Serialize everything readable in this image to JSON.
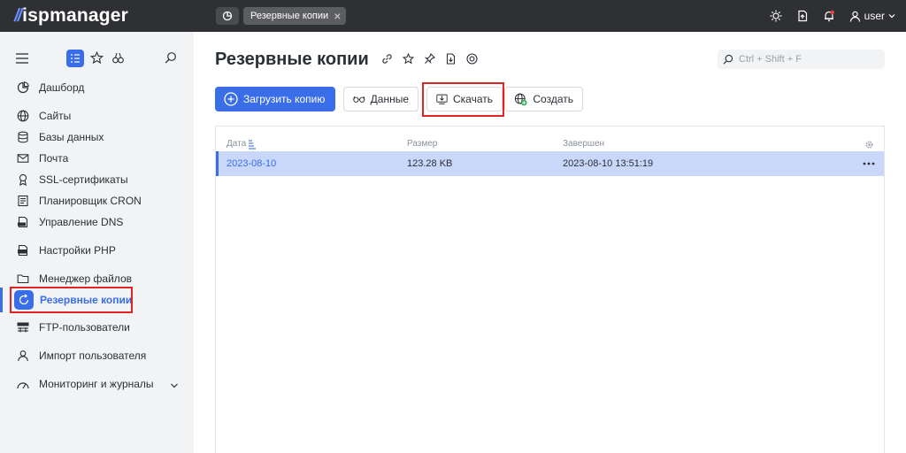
{
  "topbar": {
    "logo_mark": "//",
    "logo_text": "ispmanager",
    "tab_label": "Резервные копии",
    "tab_close": "×",
    "user_label": "user"
  },
  "sidebar": {
    "items": [
      {
        "label": "Дашборд",
        "icon": "dashboard-icon"
      },
      {
        "label": "Сайты",
        "icon": "globe-icon"
      },
      {
        "label": "Базы данных",
        "icon": "database-icon"
      },
      {
        "label": "Почта",
        "icon": "mail-icon"
      },
      {
        "label": "SSL-сертификаты",
        "icon": "certificate-icon"
      },
      {
        "label": "Планировщик CRON",
        "icon": "cron-icon"
      },
      {
        "label": "Управление DNS",
        "icon": "dns-icon"
      },
      {
        "label": "Настройки PHP",
        "icon": "php-icon"
      },
      {
        "label": "Менеджер файлов",
        "icon": "folder-icon"
      },
      {
        "label": "Резервные копии",
        "icon": "backup-icon",
        "active": true
      },
      {
        "label": "FTP-пользователи",
        "icon": "ftp-icon"
      },
      {
        "label": "Импорт пользователя",
        "icon": "user-import-icon"
      },
      {
        "label": "Мониторинг и журналы",
        "icon": "monitoring-icon"
      }
    ]
  },
  "main": {
    "title": "Резервные копии",
    "search_placeholder": "Ctrl + Shift + F",
    "toolbar": {
      "upload_label": "Загрузить копию",
      "data_label": "Данные",
      "download_label": "Скачать",
      "create_label": "Создать"
    },
    "table": {
      "columns": [
        "Дата",
        "Размер",
        "Завершен"
      ],
      "rows": [
        {
          "date": "2023-08-10",
          "size": "123.28 KB",
          "finished": "2023-08-10 13:51:19"
        }
      ]
    }
  },
  "colors": {
    "accent": "#3a6ee8",
    "topbar": "#2f3033",
    "selected_row": "#c9d7fb",
    "highlight": "#e02424"
  }
}
